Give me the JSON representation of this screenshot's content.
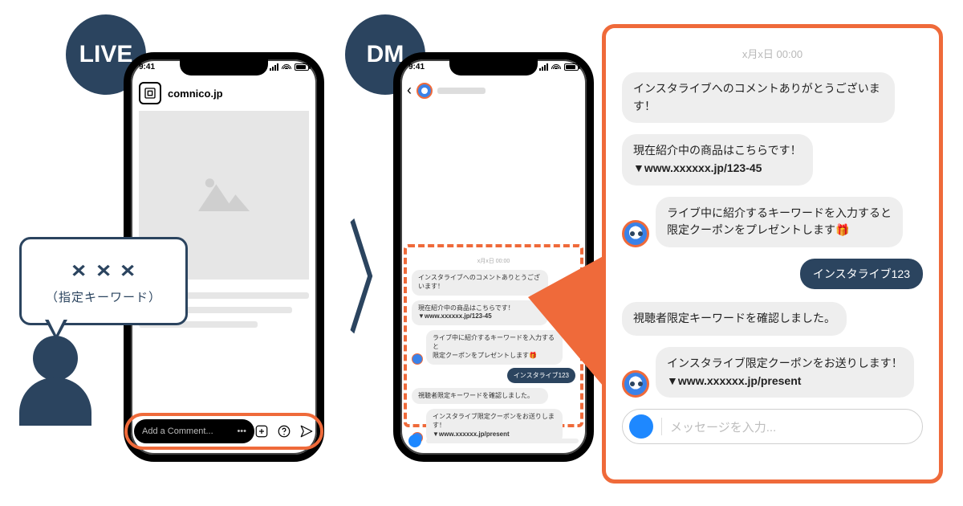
{
  "badges": {
    "live": "LIVE",
    "dm": "DM"
  },
  "live_phone": {
    "time": "9:41",
    "username": "comnico.jp",
    "comment_placeholder": "Add a Comment...",
    "comment_more": "•••"
  },
  "speech": {
    "x": "×",
    "sub": "（指定キーワード）"
  },
  "dm_phone": {
    "time": "9:41",
    "timestamp": "x月x日 00:00",
    "msg1": "インスタライブへのコメントありとうございます！",
    "msg2_a": "現在紹介中の商品はこちらです！",
    "msg2_b": "▼www.xxxxxx.jp/123-45",
    "msg3_a": "ライブ中に紹介するキーワードを入力すると",
    "msg3_b": "限定クーポンをプレゼントします🎁",
    "user_reply": "インスタライブ123",
    "msg4": "視聴者限定キーワードを確認しました。",
    "msg5_a": "インスタライブ限定クーポンをお送りします！",
    "msg5_b": "▼www.xxxxxx.jp/present"
  },
  "zoom": {
    "timestamp": "x月x日 00:00",
    "msg1": "インスタライブへのコメントありがとうございます！",
    "msg2_a": "現在紹介中の商品はこちらです！",
    "msg2_b": "▼www.xxxxxx.jp/123-45",
    "msg3_a": "ライブ中に紹介するキーワードを入力すると",
    "msg3_b": "限定クーポンをプレゼントします🎁",
    "user_reply": "インスタライブ123",
    "msg4": "視聴者限定キーワードを確認しました。",
    "msg5_a": "インスタライブ限定クーポンをお送りします！",
    "msg5_b": "▼www.xxxxxx.jp/present",
    "input_placeholder": "メッセージを入力..."
  }
}
